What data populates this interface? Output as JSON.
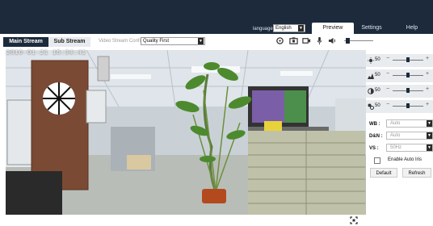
{
  "header": {
    "language_label": "language:",
    "language_value": "English",
    "tabs": [
      {
        "label": "Preview",
        "active": true
      },
      {
        "label": "Settings",
        "active": false
      },
      {
        "label": "Help",
        "active": false
      }
    ]
  },
  "stream": {
    "main_label": "Main Stream",
    "sub_label": "Sub Stream",
    "config_label": "Video Stream Config :",
    "config_value": "Quality First"
  },
  "toolbar": {
    "icons": [
      "zoom-icon",
      "snapshot-icon",
      "record-icon",
      "microphone-icon",
      "speaker-icon"
    ],
    "volume_level": 0.1
  },
  "video": {
    "timestamp": "2016-01-21 15:34:41"
  },
  "image_panel": {
    "sliders": [
      {
        "icon": "brightness-icon",
        "value": "50",
        "level": 0.5
      },
      {
        "icon": "contrast-icon",
        "value": "50",
        "level": 0.5
      },
      {
        "icon": "saturation-icon",
        "value": "50",
        "level": 0.5
      },
      {
        "icon": "sharpness-icon",
        "value": "50",
        "level": 0.5
      }
    ],
    "fields": [
      {
        "label": "WB :",
        "value": "Auto"
      },
      {
        "label": "D&N :",
        "value": "Auto"
      },
      {
        "label": "VS :",
        "value": "50Hz"
      }
    ],
    "auto_iris_label": "Enable Auto Iris",
    "auto_iris_checked": false,
    "default_button": "Default",
    "refresh_button": "Refresh"
  },
  "colors": {
    "header_bg": "#1c2a3c",
    "main_stream_bg": "#1c2a3c",
    "panel_row_bg": "#e9ecef"
  }
}
